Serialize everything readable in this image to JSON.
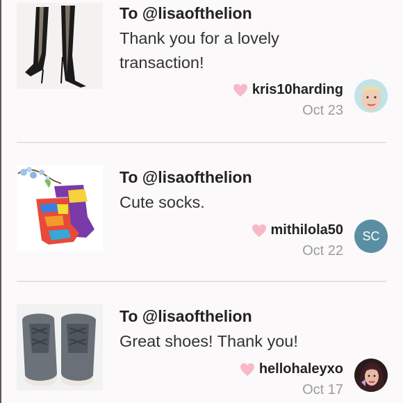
{
  "notes": [
    {
      "to": "To @lisaofthelion",
      "message": "Thank you for a lovely transaction!",
      "sender": "kris10harding",
      "date": "Oct 23",
      "avatar": {
        "type": "photo"
      },
      "thumbnail": "black-striped-boots-image"
    },
    {
      "to": "To @lisaofthelion",
      "message": "Cute socks.",
      "sender": "mithilola50",
      "date": "Oct 22",
      "avatar": {
        "type": "initials",
        "initials": "SC",
        "color": "#5a8fa3"
      },
      "thumbnail": "colorful-socks-image"
    },
    {
      "to": "To @lisaofthelion",
      "message": "Great shoes! Thank you!",
      "sender": "hellohaleyxo",
      "date": "Oct 17",
      "avatar": {
        "type": "photo"
      },
      "thumbnail": "grey-sneakers-image"
    }
  ],
  "colors": {
    "heart": "#f7b9c8",
    "date": "#9b9b9b",
    "divider": "#e3e1e3"
  },
  "icons": {
    "like": "heart-icon"
  }
}
